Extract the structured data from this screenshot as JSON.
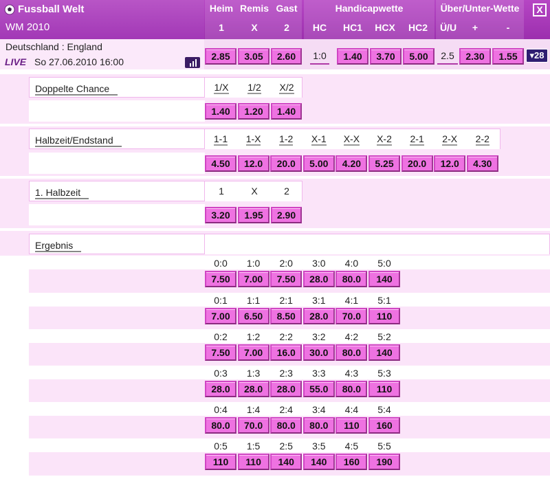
{
  "header": {
    "app_title": "Fussball Welt",
    "subtitle": "WM 2010",
    "groups": [
      {
        "label": "Heim",
        "sub": "1"
      },
      {
        "label": "Remis",
        "sub": "X"
      },
      {
        "label": "Gast",
        "sub": "2"
      }
    ],
    "handicap_label": "Handicapwette",
    "handicap_cols": [
      "HC",
      "HC1",
      "HCX",
      "HC2"
    ],
    "ou_label": "Über/Unter-Wette",
    "ou_cols": [
      "Ü/U",
      "+",
      "-"
    ],
    "close_label": "X"
  },
  "match": {
    "name": "Deutschland : England",
    "live": "LIVE",
    "date": "So 27.06.2010 16:00",
    "odds_123": [
      "2.85",
      "3.05",
      "2.60"
    ],
    "handicap_line": "1:0",
    "handicap_odds": [
      "1.40",
      "3.70",
      "5.00"
    ],
    "ou_line": "2.5",
    "ou_odds": [
      "2.30",
      "1.55"
    ],
    "more_markets": "28"
  },
  "markets": {
    "doppelte_chance": {
      "label": "Doppelte Chance",
      "cols": [
        "1/X",
        "1/2",
        "X/2"
      ],
      "odds": [
        "1.40",
        "1.20",
        "1.40"
      ]
    },
    "halbzeit_endstand": {
      "label": "Halbzeit/Endstand",
      "cols": [
        "1-1",
        "1-X",
        "1-2",
        "X-1",
        "X-X",
        "X-2",
        "2-1",
        "2-X",
        "2-2"
      ],
      "odds": [
        "4.50",
        "12.0",
        "20.0",
        "5.00",
        "4.20",
        "5.25",
        "20.0",
        "12.0",
        "4.30"
      ]
    },
    "erste_halbzeit": {
      "label": "1. Halbzeit",
      "cols": [
        "1",
        "X",
        "2"
      ],
      "odds": [
        "3.20",
        "1.95",
        "2.90"
      ]
    },
    "ergebnis": {
      "label": "Ergebnis",
      "rows": [
        {
          "scores": [
            "0:0",
            "1:0",
            "2:0",
            "3:0",
            "4:0",
            "5:0"
          ],
          "odds": [
            "7.50",
            "7.00",
            "7.50",
            "28.0",
            "80.0",
            "140"
          ]
        },
        {
          "scores": [
            "0:1",
            "1:1",
            "2:1",
            "3:1",
            "4:1",
            "5:1"
          ],
          "odds": [
            "7.00",
            "6.50",
            "8.50",
            "28.0",
            "70.0",
            "110"
          ]
        },
        {
          "scores": [
            "0:2",
            "1:2",
            "2:2",
            "3:2",
            "4:2",
            "5:2"
          ],
          "odds": [
            "7.50",
            "7.00",
            "16.0",
            "30.0",
            "80.0",
            "140"
          ]
        },
        {
          "scores": [
            "0:3",
            "1:3",
            "2:3",
            "3:3",
            "4:3",
            "5:3"
          ],
          "odds": [
            "28.0",
            "28.0",
            "28.0",
            "55.0",
            "80.0",
            "110"
          ]
        },
        {
          "scores": [
            "0:4",
            "1:4",
            "2:4",
            "3:4",
            "4:4",
            "5:4"
          ],
          "odds": [
            "80.0",
            "70.0",
            "80.0",
            "80.0",
            "110",
            "160"
          ]
        },
        {
          "scores": [
            "0:5",
            "1:5",
            "2:5",
            "3:5",
            "4:5",
            "5:5"
          ],
          "odds": [
            "110",
            "110",
            "140",
            "140",
            "160",
            "190"
          ]
        }
      ]
    }
  }
}
